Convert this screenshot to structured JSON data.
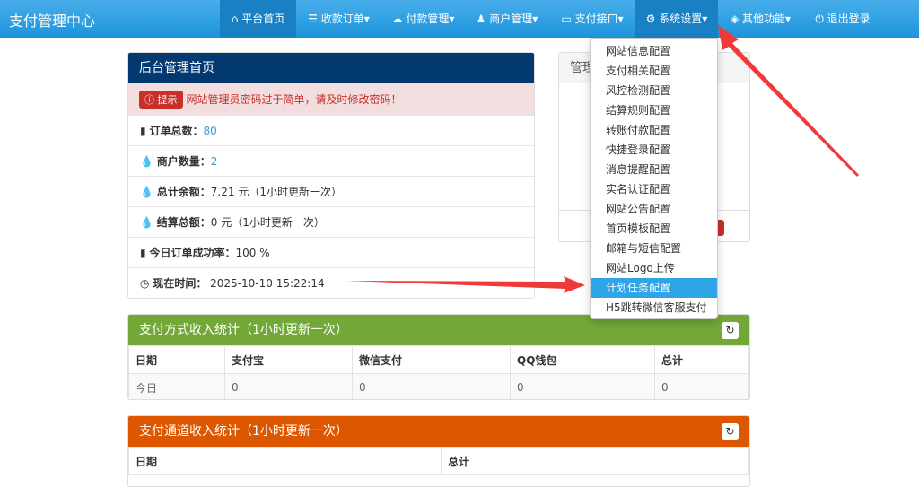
{
  "brand": "支付管理中心",
  "nav": [
    {
      "label": "平台首页",
      "icon": "home-icon"
    },
    {
      "label": "收款订单",
      "icon": "list-icon"
    },
    {
      "label": "付款管理",
      "icon": "cloud-icon"
    },
    {
      "label": "商户管理",
      "icon": "user-icon"
    },
    {
      "label": "支付接口",
      "icon": "credit-card-icon"
    },
    {
      "label": "系统设置",
      "icon": "gear-icon"
    },
    {
      "label": "其他功能",
      "icon": "cube-icon"
    },
    {
      "label": "退出登录",
      "icon": "power-icon"
    }
  ],
  "dropdown": [
    "网站信息配置",
    "支付相关配置",
    "风控检测配置",
    "结算规则配置",
    "转账付款配置",
    "快捷登录配置",
    "消息提醒配置",
    "实名认证配置",
    "网站公告配置",
    "首页模板配置",
    "邮箱与短信配置",
    "网站Logo上传",
    "计划任务配置",
    "H5跳转微信客服支付"
  ],
  "main": {
    "title": "后台管理首页",
    "alert_badge": "提示",
    "alert_text": "网站管理员密码过于简单，请及时修改密码！",
    "rows": [
      {
        "label": "订单总数：",
        "value": "80",
        "note": ""
      },
      {
        "label": "商户数量：",
        "value": "2",
        "note": ""
      },
      {
        "label": "总计余额：",
        "value": "7.21 元",
        "note": "（1小时更新一次）"
      },
      {
        "label": "结算总额：",
        "value": "0 元",
        "note": "（1小时更新一次）"
      },
      {
        "label": "今日订单成功率：",
        "value": "100 %",
        "note": ""
      },
      {
        "label": "现在时间：",
        "value": "2025-10-10 15:22:14",
        "note": ""
      }
    ]
  },
  "side_panel": {
    "title": "管理"
  },
  "pay_stats": {
    "title": "支付方式收入统计（1小时更新一次）",
    "headers": [
      "日期",
      "支付宝",
      "微信支付",
      "QQ钱包",
      "总计"
    ],
    "rows": [
      [
        "今日",
        "0",
        "0",
        "0",
        "0"
      ]
    ]
  },
  "channel_stats": {
    "title": "支付通道收入统计（1小时更新一次）",
    "headers": [
      "日期",
      "总计"
    ]
  },
  "colors": {
    "nav": "#1e94dc",
    "main_header": "#023a70",
    "green": "#73a839",
    "orange": "#dd5600",
    "alert": "#f2dede"
  }
}
